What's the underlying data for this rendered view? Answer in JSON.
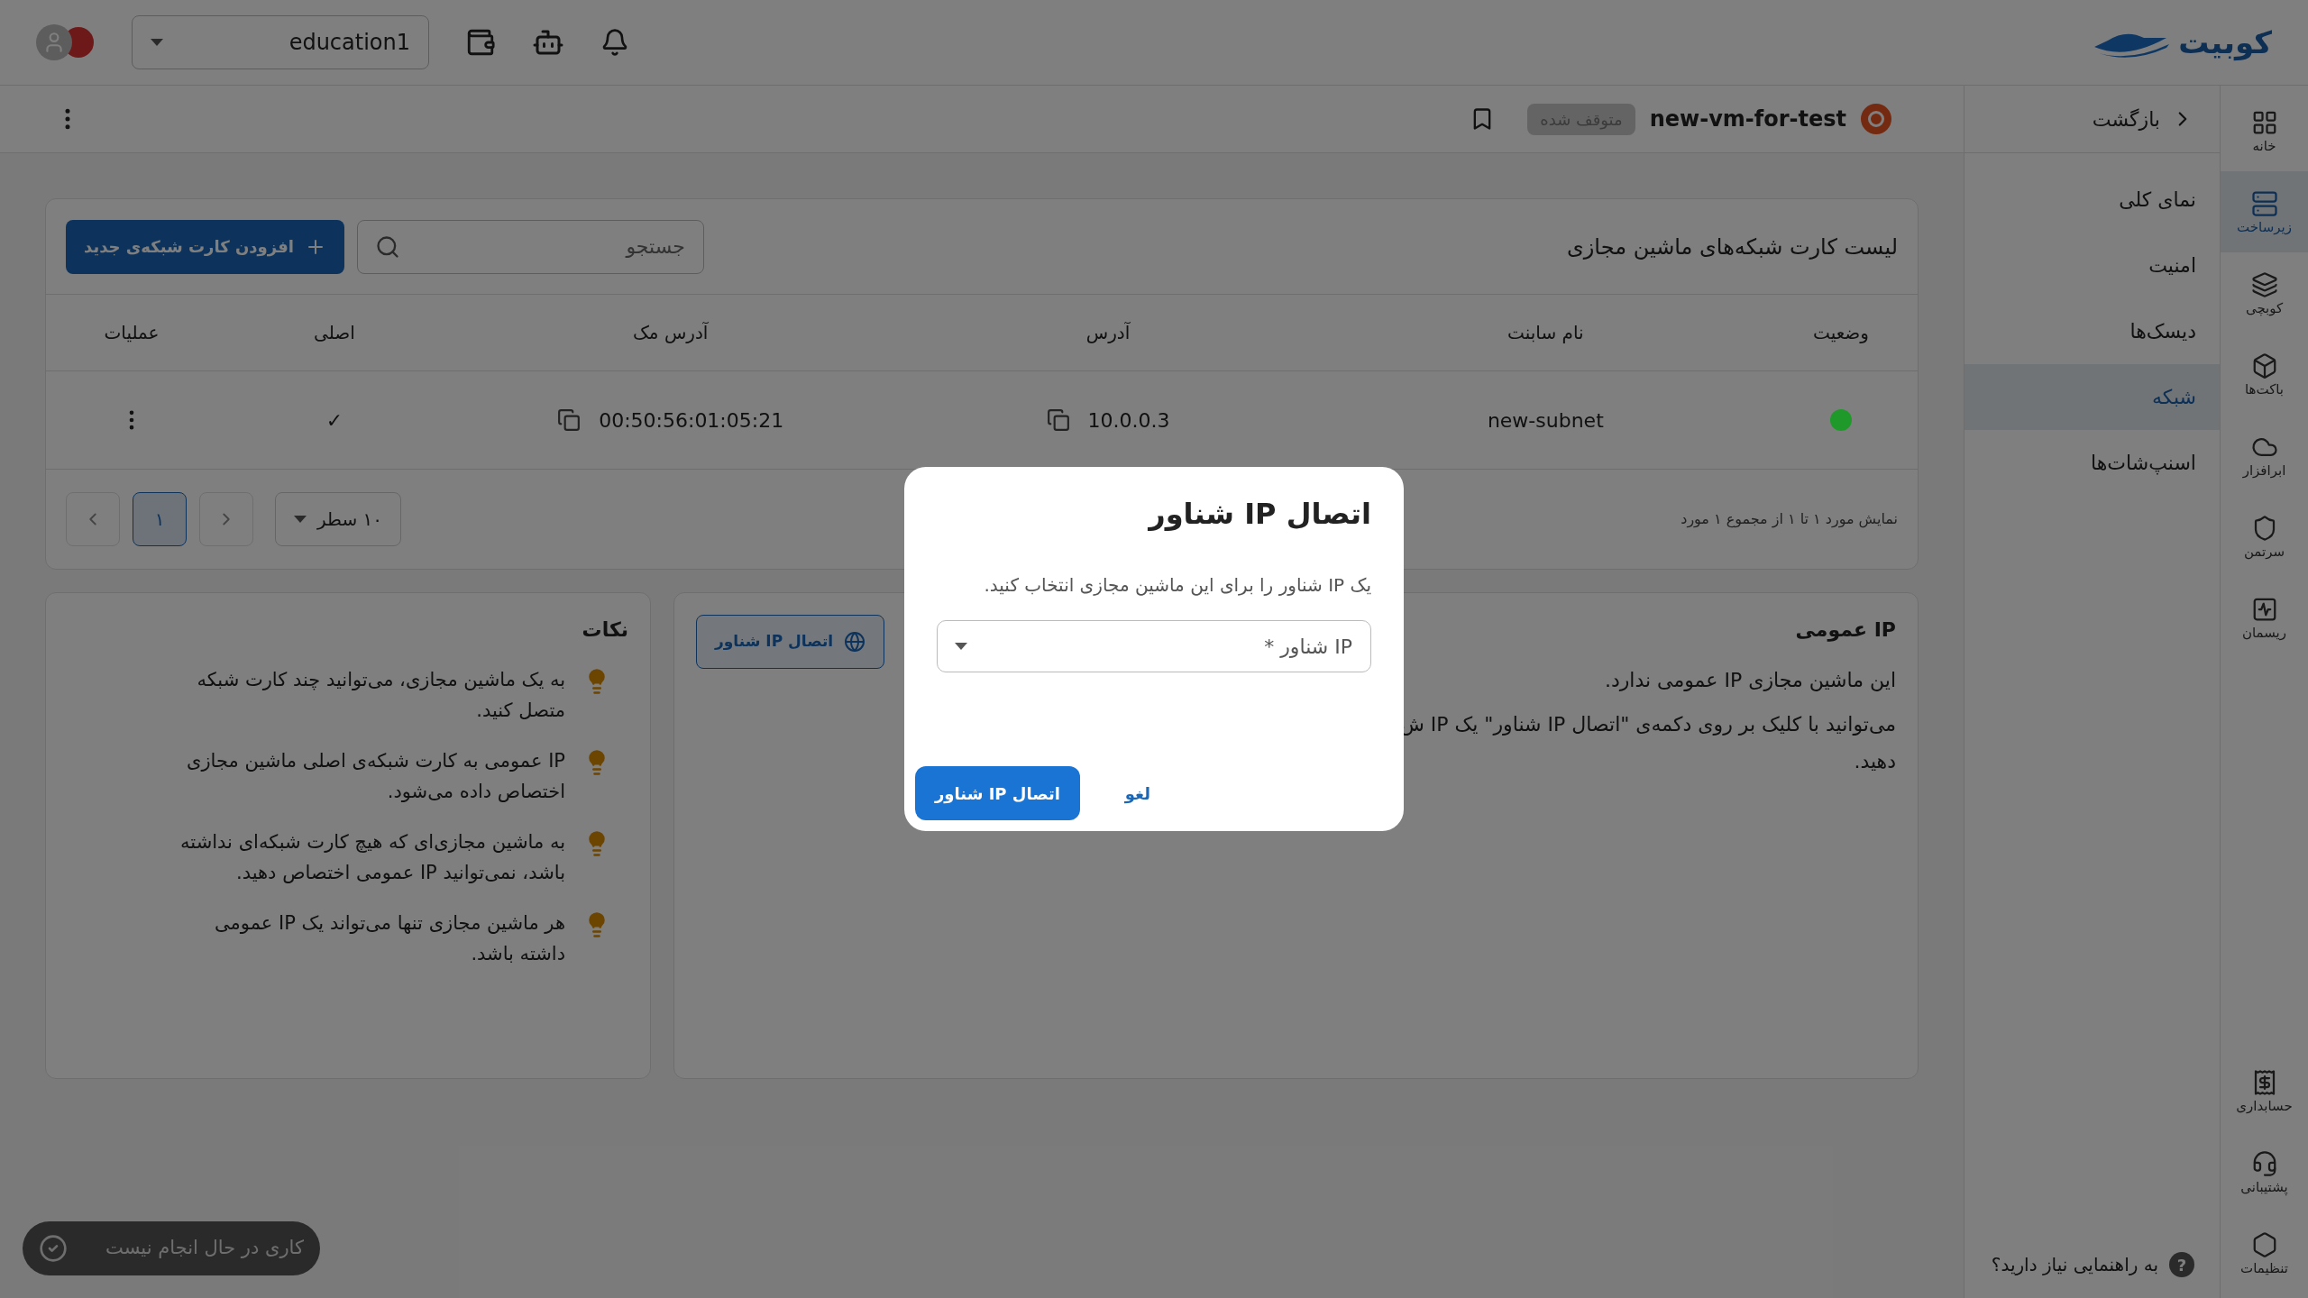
{
  "topbar": {
    "logo_text": "کوبیت",
    "project_selector": {
      "value": "education1"
    }
  },
  "header": {
    "back": "بازگشت",
    "vm_name": "new-vm-for-test",
    "status_badge": "متوقف شده"
  },
  "rail": {
    "items": [
      {
        "label": "خانه",
        "selected": false
      },
      {
        "label": "زیرساخت",
        "selected": true
      },
      {
        "label": "کوبچی",
        "selected": false
      },
      {
        "label": "باکت‌ها",
        "selected": false
      },
      {
        "label": "ابرافزار",
        "selected": false
      },
      {
        "label": "سرتمن",
        "selected": false
      },
      {
        "label": "ریسمان",
        "selected": false
      }
    ],
    "bottom_items": [
      {
        "label": "حسابداری",
        "selected": false
      },
      {
        "label": "پشتیبانی",
        "selected": false
      },
      {
        "label": "تنظیمات",
        "selected": false
      }
    ]
  },
  "sidebar": {
    "items": [
      {
        "label": "نمای کلی",
        "selected": false
      },
      {
        "label": "امنیت",
        "selected": false
      },
      {
        "label": "دیسک‌ها",
        "selected": false
      },
      {
        "label": "شبکه",
        "selected": true
      },
      {
        "label": "اسنپ‌شات‌ها",
        "selected": false
      }
    ],
    "help_icon": "?",
    "help": "به راهنمایی نیاز دارید؟"
  },
  "table": {
    "title": "لیست کارت شبکه‌های ماشین مجازی",
    "search": {
      "placeholder": "جستجو"
    },
    "add_button": "افزودن کارت شبکه‌ی جدید",
    "columns": [
      "وضعیت",
      "نام سابنت",
      "آدرس",
      "آدرس مک",
      "اصلی",
      "عملیات"
    ],
    "rows": [
      {
        "color": "#1f9a2a",
        "subnet": "new-subnet",
        "address": "10.0.0.3",
        "mac": "00:50:56:01:05:21",
        "primary": "✓"
      }
    ],
    "summary": "نمایش مورد ۱ تا ۱ از مجموع ۱ مورد",
    "rows_per_page": "۱۰ سطر",
    "pages": [
      {
        "label": "۱",
        "selected": true
      }
    ]
  },
  "public_ip": {
    "title": "IP عمومی",
    "button": "اتصال IP شناور",
    "message": "این ماشین مجازی IP عمومی ندارد.",
    "hint_line_1": "می‌توانید با کلیک بر روی دکمه‌ی \"اتصال IP شناور\" یک IP ش",
    "hint_line_2": "دهید."
  },
  "notes": {
    "title": "نکات",
    "items": [
      "به یک ماشین مجازی، می‌توانید چند کارت شبکه متصل کنید.",
      "IP عمومی به کارت شبکه‌ی اصلی ماشین مجازی اختصاص داده می‌شود.",
      "به ماشین مجازی‌ای که هیچ کارت شبکه‌ای نداشته باشد، نمی‌توانید IP عمومی اختصاص دهید.",
      "هر ماشین مجازی تنها می‌تواند یک IP عمومی داشته باشد."
    ]
  },
  "toast": "کاری در حال انجام نیست",
  "dialog": {
    "title": "اتصال IP شناور",
    "description": "یک IP شناور را برای این ماشین مجازی انتخاب کنید.",
    "select": {
      "placeholder": "IP شناور *"
    },
    "confirm": "اتصال IP شناور",
    "cancel": "لغو"
  }
}
